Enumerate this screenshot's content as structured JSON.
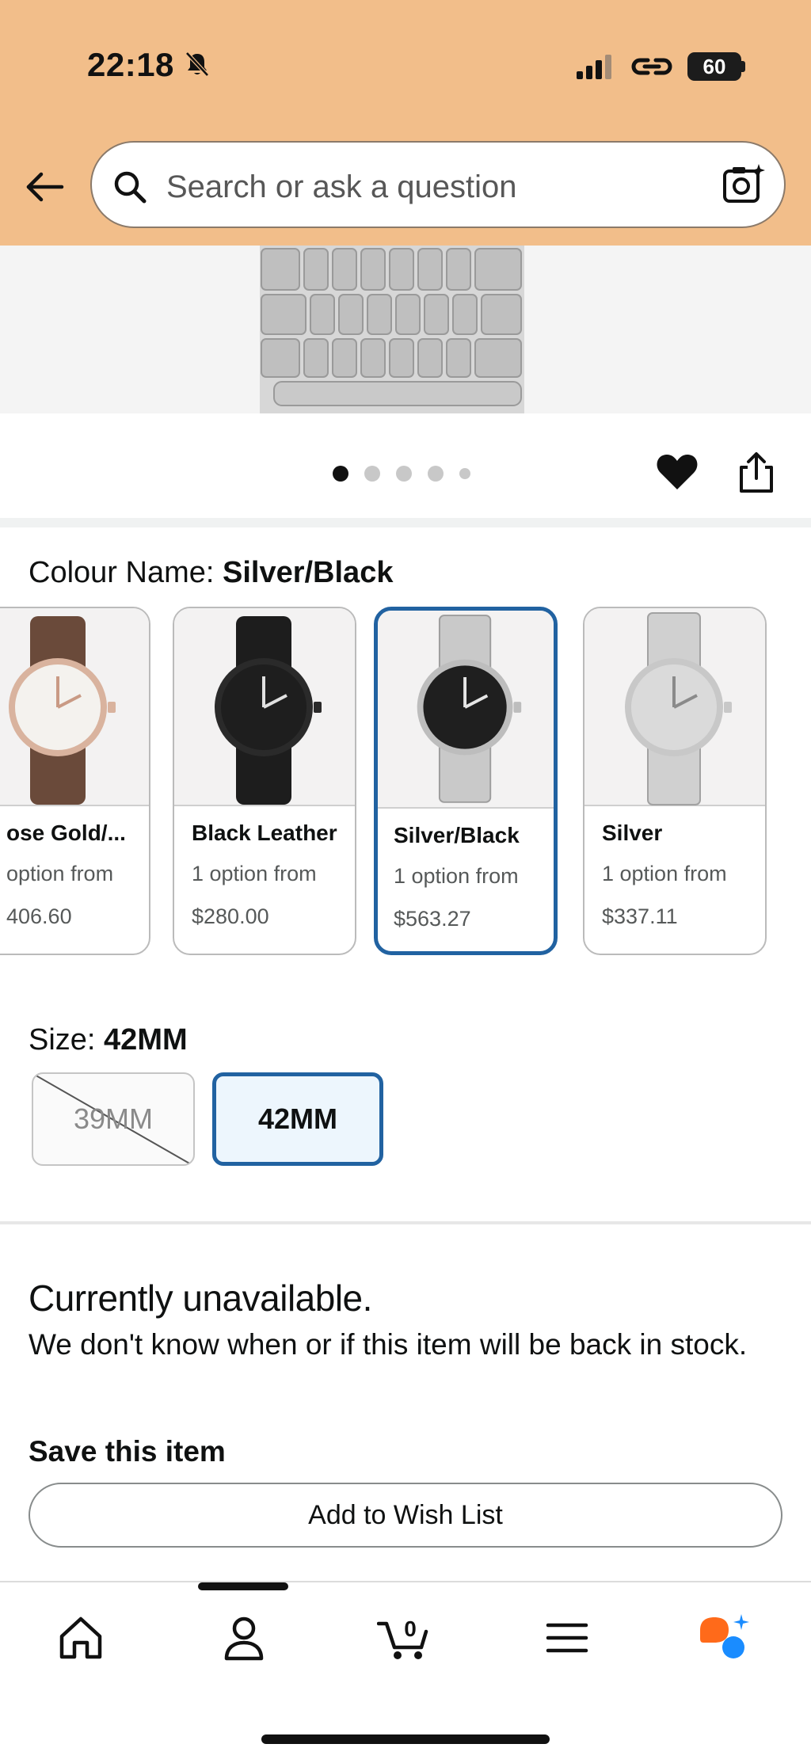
{
  "status_bar": {
    "time": "22:18",
    "battery": "60"
  },
  "search": {
    "placeholder": "Search or ask a question"
  },
  "carousel": {
    "total_dots": 5,
    "active_dot": 1
  },
  "colour": {
    "label": "Colour Name: ",
    "selected": "Silver/Black",
    "options": [
      {
        "name": "ose Gold/...",
        "availability": "option from",
        "price": "406.60",
        "dial": "#f4f2ee",
        "strap": "leather-brown",
        "case": "#d9b39e"
      },
      {
        "name": "Black Leather",
        "availability": "1 option from",
        "price": "$280.00",
        "dial": "#1e1e1e",
        "strap": "leather-black",
        "case": "#2a2a2a"
      },
      {
        "name": "Silver/Black",
        "availability": "1 option from",
        "price": "$563.27",
        "dial": "#1f1f1f",
        "strap": "steel",
        "case": "#bdbdbd"
      },
      {
        "name": "Silver",
        "availability": "1 option from",
        "price": "$337.11",
        "dial": "#dadada",
        "strap": "steel",
        "case": "#c8c8c8"
      }
    ]
  },
  "size": {
    "label": "Size: ",
    "selected": "42MM",
    "options": [
      {
        "label": "39MM",
        "available": false
      },
      {
        "label": "42MM",
        "available": true
      }
    ]
  },
  "availability": {
    "title": "Currently unavailable.",
    "message": "We don't know when or if this item will be back in stock."
  },
  "save": {
    "title": "Save this item",
    "wishlist_label": "Add to Wish List"
  },
  "bottom_nav": {
    "items": [
      {
        "name": "home",
        "icon": "home-icon"
      },
      {
        "name": "account",
        "icon": "person-icon"
      },
      {
        "name": "cart",
        "icon": "cart-icon",
        "count": "0"
      },
      {
        "name": "menu",
        "icon": "hamburger-icon"
      },
      {
        "name": "rufus",
        "icon": "ai-assistant-icon"
      }
    ]
  },
  "colors": {
    "accent_blue": "#2162a1",
    "header_bg": "#f2be8a",
    "assistant_orange": "#ff6a1a",
    "assistant_blue": "#1a8cff"
  }
}
